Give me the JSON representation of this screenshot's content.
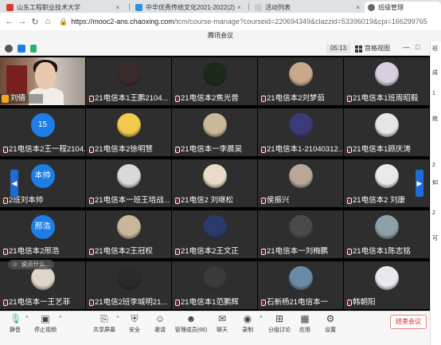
{
  "browser": {
    "tabs": [
      {
        "label": "山东工程职业技术大学",
        "color": "#d63b2f"
      },
      {
        "label": "中华优秀传统文化2021-2022(2)",
        "color": "#2f8fe0"
      },
      {
        "label": "活动列表",
        "color": "#aaaaaa"
      },
      {
        "label": "班级管理",
        "color": "#666666"
      }
    ],
    "close_glyph": "×",
    "url_host": "https://mooc2-ans.chaoxing.com",
    "url_path": "/tcm/course-manage?courseid=220694349&clazzid=53396019&cpi=166299765"
  },
  "meeting": {
    "window_title": "腾讯会议",
    "timer": "05:13",
    "view_label": "宫格视图",
    "chat_placeholder": "说点什么...",
    "left_arrow": "◀",
    "right_arrow": "▶"
  },
  "participants": [
    {
      "name": "刘倩",
      "kind": "video"
    },
    {
      "name": "21电信本1王鹏2104...",
      "kind": "avatar",
      "color": "#3a2a2a"
    },
    {
      "name": "21电信本2焦光普",
      "kind": "avatar",
      "color": "#1c2a1c"
    },
    {
      "name": "21电信本2刘梦茹",
      "kind": "avatar",
      "color": "#c9a98a"
    },
    {
      "name": "21电信本1班周昭毅",
      "kind": "avatar",
      "color": "#d8d0e0"
    },
    {
      "name": "21电信本2王一程2104...",
      "kind": "circle",
      "text": "15",
      "color": "#1e7ee6"
    },
    {
      "name": "21电信本2徐明慧",
      "kind": "avatar",
      "color": "#f2c94c"
    },
    {
      "name": "21电信本一李晨昊",
      "kind": "avatar",
      "color": "#cbb89a"
    },
    {
      "name": "21电信本1-21040312...",
      "kind": "avatar",
      "color": "#3b3b7a"
    },
    {
      "name": "21电信本1顾庆涛",
      "kind": "avatar",
      "color": "#e6e6e6"
    },
    {
      "name": "2班刘本帅",
      "kind": "circle",
      "text": "本帅",
      "color": "#1e7ee6"
    },
    {
      "name": "21电信本一班王培战...",
      "kind": "avatar",
      "color": "#d9d9d9"
    },
    {
      "name": "21电信2 刘继松",
      "kind": "avatar",
      "color": "#e8dcc8"
    },
    {
      "name": "侯振兴",
      "kind": "avatar",
      "color": "#b8a898"
    },
    {
      "name": "21电信本2 刘康",
      "kind": "avatar",
      "color": "#eaeaea"
    },
    {
      "name": "21电信本2邢浩",
      "kind": "circle",
      "text": "邢浩",
      "color": "#1e7ee6"
    },
    {
      "name": "21电信本2王冠权",
      "kind": "avatar",
      "color": "#c9b79c"
    },
    {
      "name": "21电信本2王文正",
      "kind": "avatar",
      "color": "#2a3a6a"
    },
    {
      "name": "21电信本一刘梅鹏",
      "kind": "avatar",
      "color": "#4a4a4a"
    },
    {
      "name": "21电信本1陈志铭",
      "kind": "avatar",
      "color": "#8fa0a8"
    },
    {
      "name": "21电信本一王艺菲",
      "kind": "avatar",
      "color": "#e0d6c8"
    },
    {
      "name": "21电信2班李城明21...",
      "kind": "avatar",
      "color": "#2a2a2a"
    },
    {
      "name": "21电信本1范鹏辉",
      "kind": "avatar",
      "color": "#3a3a3a"
    },
    {
      "name": "石新杨21电信本一",
      "kind": "avatar",
      "color": "#6a8aa8"
    },
    {
      "name": "韩朝阳",
      "kind": "avatar",
      "color": "#e8e8ee"
    }
  ],
  "toolbar": {
    "mute": "静音",
    "stop_video": "停止视频",
    "share": "共享屏幕",
    "security": "安全",
    "invite": "邀请",
    "members": "管理成员(66)",
    "chat": "聊天",
    "record": "录制",
    "breakout": "分组讨论",
    "apps": "应用",
    "settings": "设置",
    "end": "结束会议"
  },
  "right_panel_chars": [
    "班",
    "成",
    "1",
    "统",
    "2",
    "如",
    "2",
    "可"
  ]
}
